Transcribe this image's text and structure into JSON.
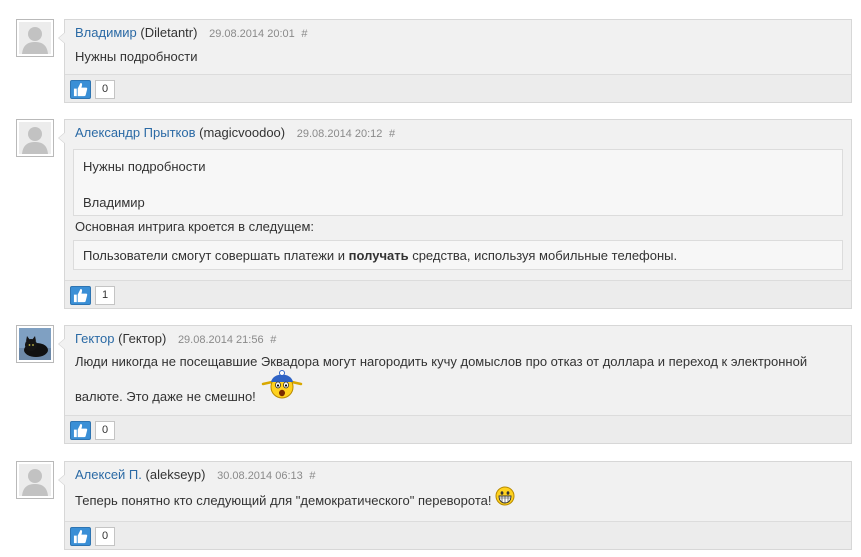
{
  "comments": [
    {
      "author": "Владимир",
      "login": "(Diletantr)",
      "date": "29.08.2014 20:01",
      "hash": "#",
      "text": "Нужны подробности",
      "likes": "0"
    },
    {
      "author": "Александр Прытков",
      "login": "(magicvoodoo)",
      "date": "29.08.2014 20:12",
      "hash": "#",
      "quote": {
        "text": "Нужны подробности",
        "author": "Владимир"
      },
      "text": "Основная интрига кроется в следущем:",
      "quote2": {
        "before": "Пользователи смогут совершать платежи и ",
        "bold": "получать",
        "after": " средства, используя мобильные телефоны."
      },
      "likes": "1"
    },
    {
      "author": "Гектор",
      "login": "(Гектор)",
      "date": "29.08.2014 21:56",
      "hash": "#",
      "text_line1": "Люди никогда не посещавшие Эквадора могут нагородить кучу домыслов про отказ от доллара и переход к электронной",
      "text_line2": "валюте. Это даже не смешно!",
      "likes": "0"
    },
    {
      "author": "Алексей П.",
      "login": "(alekseyp)",
      "date": "30.08.2014 06:13",
      "hash": "#",
      "text": "Теперь понятно кто следующий для \"демократического\" переворота!",
      "likes": "0"
    }
  ],
  "icons": {
    "avatar_default": "user-silhouette-icon",
    "avatar_cat": "black-cat-avatar",
    "like": "thumbs-up-icon",
    "smiley_surprised": "surprised-smiley-icon",
    "smiley_grin": "grin-smiley-icon"
  },
  "colors": {
    "author_link": "#2b6aa5",
    "like_button": "#3a8fd6",
    "card_bg": "#f1f1f1"
  }
}
